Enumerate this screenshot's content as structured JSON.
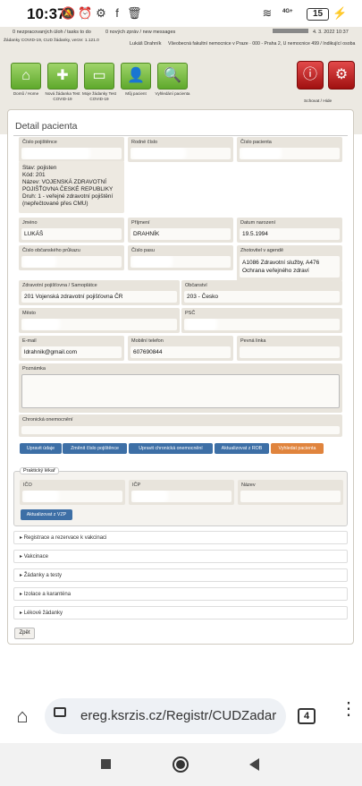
{
  "status_bar": {
    "time": "10:37",
    "net_label": "4G+",
    "battery": "15"
  },
  "app_header": {
    "tasks": "0 nezpracovaných úloh / tasks to do",
    "messages": "0 nových zpráv / new messages",
    "date": "4. 3. 2022 10:37",
    "user": "Lukáš Drahník",
    "hospital": "Všeobecná fakultní nemocnice v Praze · 000 - Praha 2, U nemocnice 499 / Indikující osoba",
    "version": "Žádanky COVID-19, CUD žádanky, verze: 1.121.0",
    "hide_label": "Schovat / Hide",
    "nav": [
      {
        "label": "Domů / Home",
        "icon": "home-icon"
      },
      {
        "label": "Nová žádanka Test COVID-19",
        "icon": "add-user-icon"
      },
      {
        "label": "Moje žádanky Test COVID-19",
        "icon": "inbox-icon"
      },
      {
        "label": "Můj pacient",
        "icon": "patient-icon"
      },
      {
        "label": "Vyhledání pacienta",
        "icon": "search-icon"
      }
    ]
  },
  "page": {
    "title": "Detail pacienta",
    "fields": {
      "insurance_number": {
        "label": "Číslo pojištěnce"
      },
      "birth_number": {
        "label": "Rodné číslo"
      },
      "patient_number": {
        "label": "Číslo pacienta"
      },
      "insurance_info": [
        "Stav: pojisten",
        "Kód: 201",
        "Název: VOJENSKÁ ZDRAVOTNÍ POJIŠŤOVNA ČESKÉ REPUBLIKY",
        "Druh: 1 - veřejné zdravotní pojištění (nepřečtované přes CMU)"
      ],
      "first_name": {
        "label": "Jméno",
        "value": "LUKÁŠ"
      },
      "last_name": {
        "label": "Příjmení",
        "value": "DRAHNÍK"
      },
      "birth_date": {
        "label": "Datum narození",
        "value": "19.5.1994"
      },
      "id_card": {
        "label": "Číslo občanského průkazu"
      },
      "passport": {
        "label": "Číslo pasu"
      },
      "registered_by": {
        "label": "Zhotovitel v agendě",
        "value": "A1086 Zdravotní služby, A476 Ochrana veřejného zdraví"
      },
      "insurer": {
        "label": "Zdravotní pojišťovna / Samoplátce",
        "value": "201 Vojenská zdravotní pojišťovna ČR"
      },
      "citizenship": {
        "label": "Občanství",
        "value": "203 - Česko"
      },
      "city": {
        "label": "Město"
      },
      "zip": {
        "label": "PSČ"
      },
      "email": {
        "label": "E-mail",
        "value": "ldrahnik@gmail.com"
      },
      "mobile": {
        "label": "Mobilní telefon",
        "value": "607690844"
      },
      "landline": {
        "label": "Pevná linka",
        "value": ""
      },
      "note": {
        "label": "Poznámka",
        "value": ""
      },
      "chronic": {
        "label": "Chronická onemocnění",
        "value": ""
      }
    },
    "buttons": [
      "Upravit údaje",
      "Změnit číslo pojištěnce",
      "Upravit chronická onemocnění",
      "Aktualizovat z ROB",
      "Vyhledat pacienta"
    ],
    "gp": {
      "legend": "Praktický lékař",
      "ico_label": "IČO",
      "icp_label": "IČP",
      "name_label": "Název",
      "update_button": "Aktualizovat z VZP"
    },
    "accordions": [
      "Registrace a rezervace k vakcinaci",
      "Vakcinace",
      "Žádanky a testy",
      "Izolace a karanténa",
      "Lékové žádanky"
    ],
    "back_button": "Zpět"
  },
  "browser": {
    "url": "ereg.ksrzis.cz/Registr/CUDZadar",
    "tabs_count": "4"
  },
  "colors": {
    "green": "#6fb43a",
    "red": "#c21a1a",
    "blue": "#3d6fa6",
    "orange": "#e0843d"
  }
}
